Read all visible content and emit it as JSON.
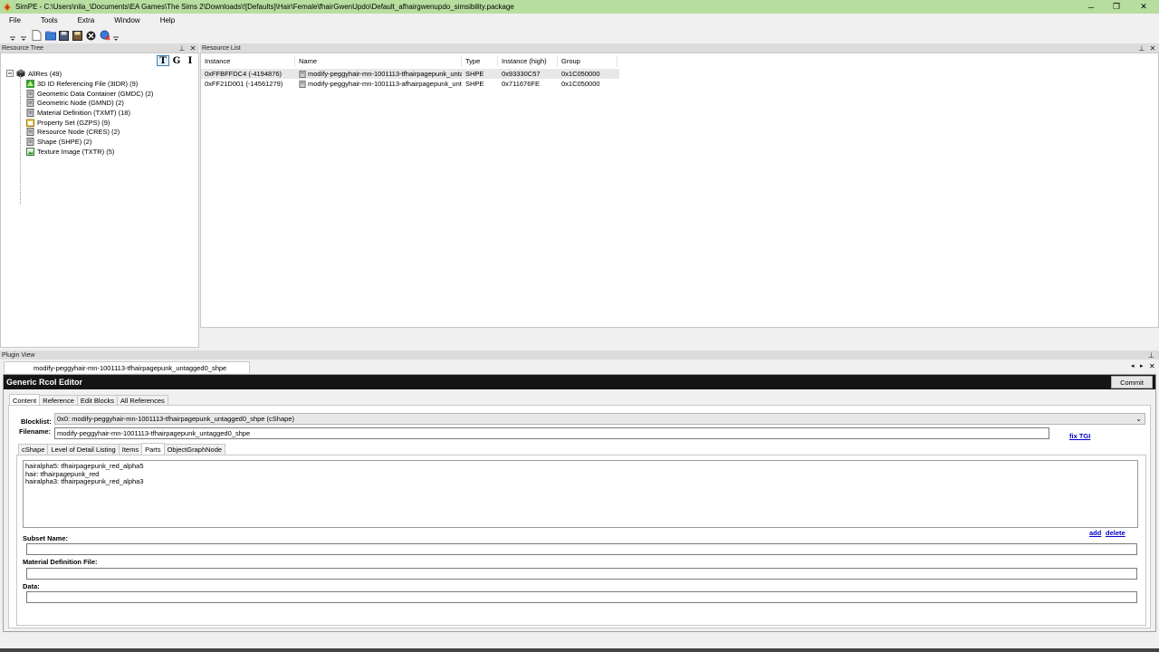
{
  "window": {
    "title": "SimPE - C:\\Users\\nila_\\Documents\\EA Games\\The Sims 2\\Downloads\\![Defaults]\\Hair\\Female\\fhairGwenUpdo\\Default_afhairgwenupdo_simsibility.package",
    "controls": {
      "minimize": "─",
      "restore": "❐",
      "close": "✕"
    }
  },
  "menu": [
    "File",
    "Tools",
    "Extra",
    "Window",
    "Help"
  ],
  "toolbar": {
    "icons": [
      "new-icon",
      "open-icon",
      "save-icon",
      "save-all-icon",
      "close-package-icon",
      "tools-icon"
    ]
  },
  "resource_tree": {
    "header": "Resource Tree",
    "modes": [
      "T",
      "G",
      "I"
    ],
    "root": "AllRes (49)",
    "items": [
      {
        "label": "3D ID Referencing File (3IDR) (9)",
        "icon": "3idr-icon"
      },
      {
        "label": "Geometric Data Container (GMDC) (2)",
        "icon": "gmdc-icon"
      },
      {
        "label": "Geometric Node (GMND) (2)",
        "icon": "gmnd-icon"
      },
      {
        "label": "Material Definition (TXMT) (18)",
        "icon": "txmt-icon"
      },
      {
        "label": "Property Set (GZPS) (9)",
        "icon": "gzps-icon"
      },
      {
        "label": "Resource Node (CRES) (2)",
        "icon": "cres-icon"
      },
      {
        "label": "Shape (SHPE) (2)",
        "icon": "shpe-icon"
      },
      {
        "label": "Texture Image (TXTR) (5)",
        "icon": "txtr-icon"
      }
    ]
  },
  "resource_list": {
    "header": "Resource List",
    "columns": [
      "Instance",
      "Name",
      "Type",
      "Instance (high)",
      "Group"
    ],
    "rows": [
      {
        "instance": "0xFFBFFDC4 (-4194876)",
        "name": "modify-peggyhair-mn-1001113-tfhairpagepunk_unta...",
        "type": "SHPE",
        "instance_high": "0x93330C57",
        "group": "0x1C050000"
      },
      {
        "instance": "0xFF21D001 (-14561279)",
        "name": "modify-peggyhair-mn-1001113-afhairpagepunk_unt...",
        "type": "SHPE",
        "instance_high": "0x711676FE",
        "group": "0x1C050000"
      }
    ]
  },
  "plugin_view": {
    "header": "Plugin View",
    "doc_tab": "modify-peggyhair-mn-1001113-tfhairpagepunk_untagged0_shpe",
    "editor_title": "Generic Rcol Editor",
    "commit": "Commit",
    "tabs": [
      "Content",
      "Reference",
      "Edit Blocks",
      "All References"
    ],
    "blocklist_label": "Blocklist:",
    "blocklist_value": "0x0: modify-peggyhair-mn-1001113-tfhairpagepunk_untagged0_shpe (cShape)",
    "filename_label": "Filename:",
    "filename_value": "modify-peggyhair-mn-1001113-tfhairpagepunk_untagged0_shpe",
    "fix_tgi": "fix TGI",
    "subtabs": [
      "cShape",
      "Level of Detail Listing",
      "Items",
      "Parts",
      "ObjectGraphNode"
    ],
    "parts": [
      "hairalpha5: tfhairpagepunk_red_alpha5",
      "hair: tfhairpagepunk_red",
      "hairalpha3: tfhairpagepunk_red_alpha3"
    ],
    "add": "add",
    "delete": "delete",
    "subset_label": "Subset Name:",
    "subset_value": "",
    "material_label": "Material Definition File:",
    "material_value": "",
    "data_label": "Data:",
    "data_value": ""
  }
}
